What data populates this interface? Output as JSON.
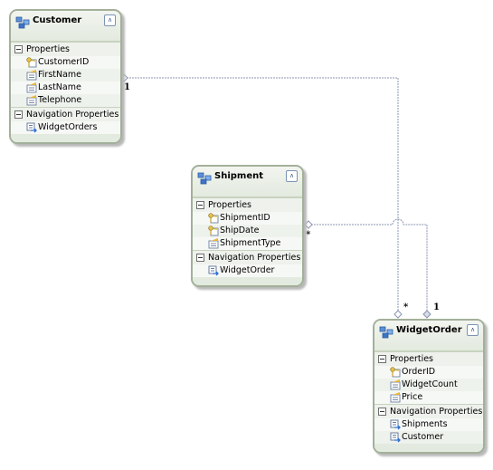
{
  "entities": {
    "customer": {
      "name": "Customer",
      "properties_label": "Properties",
      "properties": [
        {
          "name": "CustomerID",
          "key": true
        },
        {
          "name": "FirstName",
          "key": false
        },
        {
          "name": "LastName",
          "key": false
        },
        {
          "name": "Telephone",
          "key": false
        }
      ],
      "nav_label": "Navigation Properties",
      "navigation": [
        "WidgetOrders"
      ]
    },
    "shipment": {
      "name": "Shipment",
      "properties_label": "Properties",
      "properties": [
        {
          "name": "ShipmentID",
          "key": true
        },
        {
          "name": "ShipDate",
          "key": true
        },
        {
          "name": "ShipmentType",
          "key": false
        }
      ],
      "nav_label": "Navigation Properties",
      "navigation": [
        "WidgetOrder"
      ]
    },
    "widgetorder": {
      "name": "WidgetOrder",
      "properties_label": "Properties",
      "properties": [
        {
          "name": "OrderID",
          "key": true
        },
        {
          "name": "WidgetCount",
          "key": false
        },
        {
          "name": "Price",
          "key": false
        }
      ],
      "nav_label": "Navigation Properties",
      "navigation": [
        "Shipments",
        "Customer"
      ]
    }
  },
  "associations": [
    {
      "from": "Customer",
      "to": "WidgetOrder",
      "from_multiplicity": "1",
      "to_multiplicity": "*"
    },
    {
      "from": "Shipment",
      "to": "WidgetOrder",
      "from_multiplicity": "*",
      "to_multiplicity": "1"
    }
  ],
  "colors": {
    "connector": "#8a94b0",
    "border": "#a3b09a",
    "background": "#e3eadf"
  }
}
